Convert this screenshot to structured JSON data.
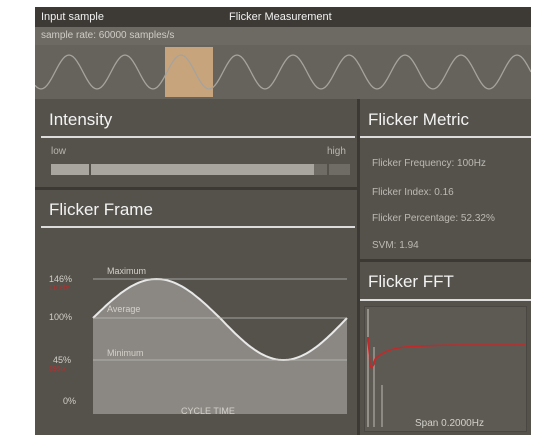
{
  "header": {
    "input_sample": "Input sample",
    "title": "Flicker Measurement",
    "sample_rate": "sample rate: 60000 samples/s"
  },
  "intensity": {
    "title": "Intensity",
    "low_label": "low",
    "high_label": "high",
    "level": 0.88
  },
  "flicker_metric": {
    "title": "Flicker Metric",
    "frequency": "Flicker Frequency: 100Hz",
    "index": "Flicker Index: 0.16",
    "percentage": "Flicker Percentage: 52.32%",
    "svm": "SVM: 1.94"
  },
  "flicker_frame": {
    "title": "Flicker Frame",
    "max_pct": "146%",
    "max_unit": "1108lx",
    "avg_pct": "100%",
    "min_pct": "45%",
    "min_unit": "395lx",
    "zero_pct": "0%",
    "maximum_label": "Maximum",
    "average_label": "Average",
    "minimum_label": "Minimum",
    "x_axis_label": "CYCLE TIME"
  },
  "flicker_fft": {
    "title": "Flicker FFT",
    "span": "Span 0.2000Hz"
  },
  "colors": {
    "frame_bg": "#535049",
    "waveform": "#9c9993",
    "selection": "#c7a47c",
    "curve_fill": "#8b8883",
    "fft_line": "#c22a2a"
  }
}
